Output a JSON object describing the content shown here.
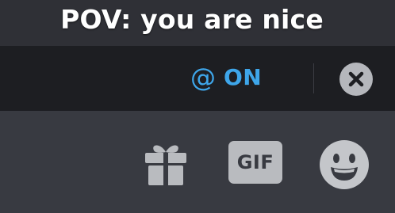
{
  "caption": {
    "text": "POV: you are nice"
  },
  "reply_bar": {
    "mention_symbol": "@",
    "mention_state": "ON",
    "close_icon": "close-circle-icon"
  },
  "toolbar": {
    "gift_icon": "gift-icon",
    "gif_label": "GIF",
    "emoji_icon": "smiley-emoji-icon"
  },
  "colors": {
    "accent": "#3ea6ea",
    "reply_bar_bg": "#1d1e22",
    "toolbar_bg": "#383a41",
    "icon_gray": "#b9bbbf"
  }
}
